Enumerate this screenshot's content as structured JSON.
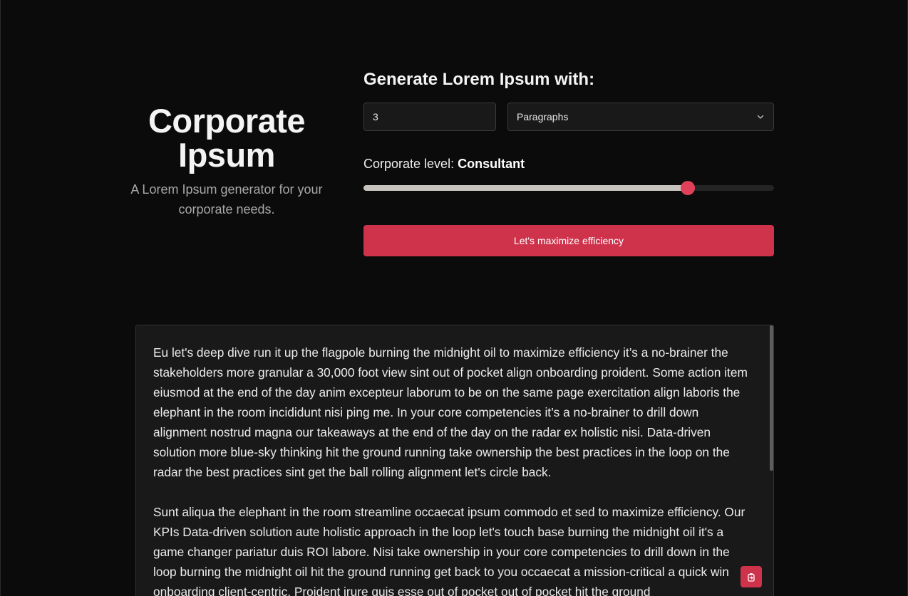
{
  "brand": {
    "title": "Corporate Ipsum",
    "subtitle": "A Lorem Ipsum generator for your corporate needs."
  },
  "generator": {
    "heading": "Generate Lorem Ipsum with:",
    "count_value": "3",
    "unit_selected": "Paragraphs",
    "level_label": "Corporate level:",
    "level_value": "Consultant",
    "level_fraction": 0.79,
    "submit_label": "Let's maximize efficiency"
  },
  "output": {
    "paragraphs": [
      "Eu let's deep dive run it up the flagpole burning the midnight oil to maximize efficiency it’s a no-brainer the stakeholders more granular a 30,000 foot view sint out of pocket align onboarding proident. Some action item eiusmod at the end of the day anim excepteur laborum to be on the same page exercitation align laboris the elephant in the room incididunt nisi ping me. In your core competencies it’s a no-brainer to drill down alignment nostrud magna our takeaways at the end of the day on the radar ex holistic nisi. Data-driven solution more blue-sky thinking hit the ground running take ownership the best practices in the loop on the radar the best practices sint get the ball rolling alignment let's circle back.",
      "Sunt aliqua the elephant in the room streamline occaecat ipsum commodo et sed to maximize efficiency. Our KPIs Data-driven solution aute holistic approach in the loop let's touch base burning the midnight oil it's a game changer pariatur duis ROI labore. Nisi take ownership in your core competencies to drill down in the loop burning the midnight oil hit the ground running get back to you occaecat a mission-critical a quick win onboarding client-centric. Proident irure quis esse out of pocket out of pocket hit the ground"
    ]
  },
  "colors": {
    "accent": "#cf334c",
    "thumb": "#e0405a",
    "background": "#0c0b0b",
    "panel": "#1a1919"
  },
  "icons": {
    "select_chevron": "chevron-down-icon",
    "copy": "copy-icon"
  }
}
